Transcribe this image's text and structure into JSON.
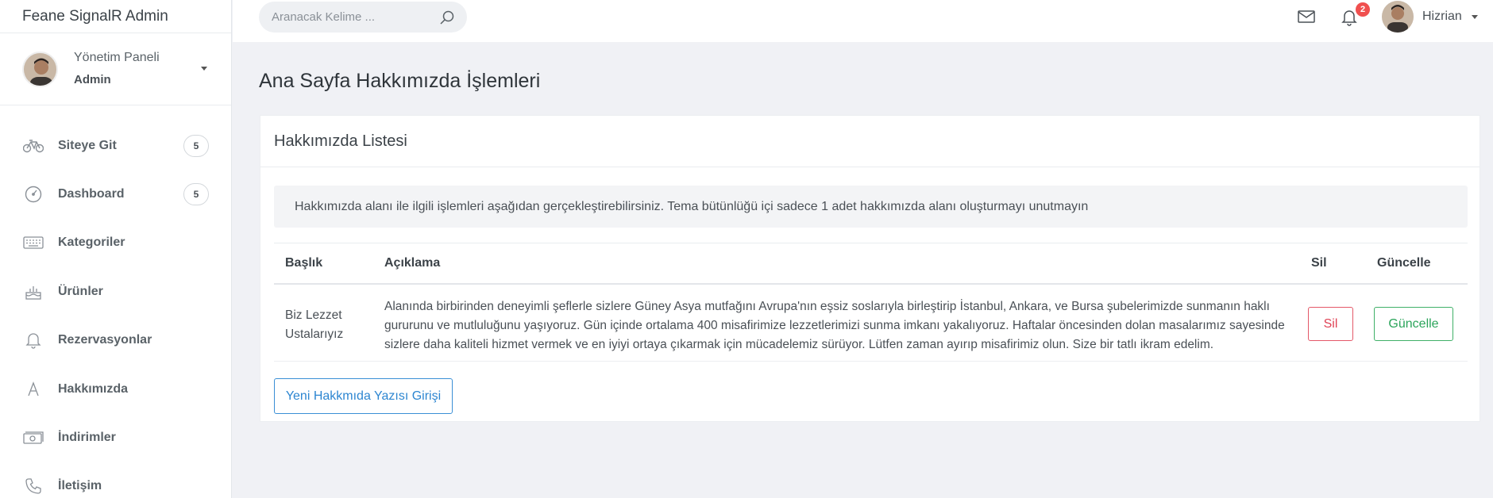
{
  "brand": "Feane SignalR Admin",
  "profile": {
    "title": "Yönetim Paneli",
    "role": "Admin"
  },
  "sidebar": {
    "items": [
      {
        "label": "Siteye Git",
        "badge": "5",
        "icon": "bicycle-icon"
      },
      {
        "label": "Dashboard",
        "badge": "5",
        "icon": "speedometer-icon"
      },
      {
        "label": "Kategoriler",
        "icon": "keyboard-icon"
      },
      {
        "label": "Ürünler",
        "icon": "cake-icon"
      },
      {
        "label": "Rezervasyonlar",
        "icon": "bell-icon"
      },
      {
        "label": "Hakkımızda",
        "icon": "font-a-icon"
      },
      {
        "label": "İndirimler",
        "icon": "cash-icon"
      },
      {
        "label": "İletişim",
        "icon": "phone-icon"
      }
    ]
  },
  "topbar": {
    "search_placeholder": "Aranacak Kelime ...",
    "notification_count": "2",
    "user_name": "Hizrian"
  },
  "page": {
    "title": "Ana Sayfa Hakkımızda İşlemleri",
    "card_title": "Hakkımızda Listesi",
    "info": "Hakkımızda alanı ile ilgili işlemleri aşağıdan gerçekleştirebilirsiniz. Tema bütünlüğü içi sadece 1 adet hakkımızda alanı oluşturmayı unutmayın",
    "table": {
      "headers": {
        "title": "Başlık",
        "description": "Açıklama",
        "delete": "Sil",
        "update": "Güncelle"
      },
      "rows": [
        {
          "title": "Biz Lezzet Ustalarıyız",
          "description": "Alanında birbirinden deneyimli şeflerle sizlere Güney Asya mutfağını Avrupa'nın eşsiz soslarıyla birleştirip İstanbul, Ankara, ve Bursa şubelerimizde sunmanın haklı gururunu ve mutluluğunu yaşıyoruz. Gün içinde ortalama 400 misafirimize lezzetlerimizi sunma imkanı yakalıyoruz. Haftalar öncesinden dolan masalarımız sayesinde sizlere daha kaliteli hizmet vermek ve en iyiyi ortaya çıkarmak için mücadelemiz sürüyor. Lütfen zaman ayırıp misafirimiz olun. Size bir tatlı ikram edelim.",
          "delete_label": "Sil",
          "update_label": "Güncelle"
        }
      ]
    },
    "new_button": "Yeni Hakkmıda Yazısı Girişi"
  },
  "colors": {
    "danger": "#e04356",
    "success": "#2aa45a",
    "primary": "#2d86d1",
    "badge": "#f0504f"
  }
}
